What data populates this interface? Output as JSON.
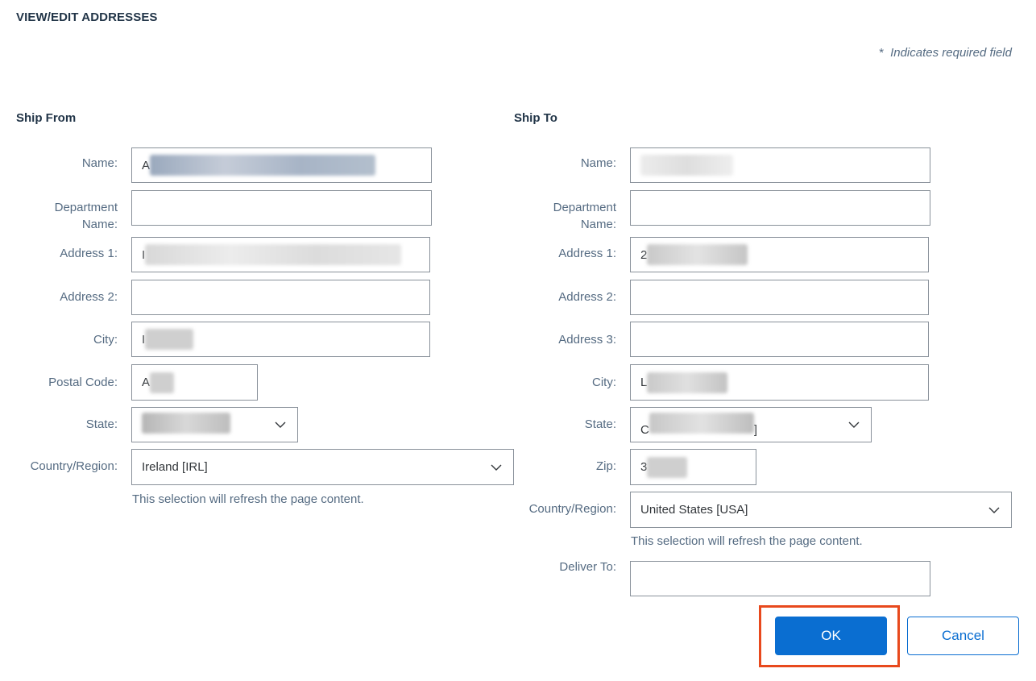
{
  "header": {
    "title": "VIEW/EDIT ADDRESSES",
    "required_star": "*",
    "required_note": "Indicates required field"
  },
  "ship_from": {
    "section_title": "Ship From",
    "labels": {
      "name": "Name:",
      "department_line1": "Department",
      "department_line2": "Name:",
      "address1": "Address 1:",
      "address2": "Address 2:",
      "city": "City:",
      "postal_code": "Postal Code:",
      "state": "State:",
      "country": "Country/Region:"
    },
    "values": {
      "name": "A",
      "address1": "I",
      "city": "I",
      "postal_code": "A",
      "country": "Ireland  [IRL]"
    },
    "country_hint": "This selection will refresh the page content."
  },
  "ship_to": {
    "section_title": "Ship To",
    "labels": {
      "name": "Name:",
      "department_line1": "Department",
      "department_line2": "Name:",
      "address1": "Address 1:",
      "address2": "Address 2:",
      "address3": "Address 3:",
      "city": "City:",
      "state": "State:",
      "zip": "Zip:",
      "country": "Country/Region:",
      "deliver_to": "Deliver To:"
    },
    "values": {
      "address1": "2",
      "city": "L",
      "state": "C",
      "state_suffix": "]",
      "zip": "3",
      "country": "United States  [USA]"
    },
    "country_hint": "This selection will refresh the page content."
  },
  "actions": {
    "ok_label": "OK",
    "cancel_label": "Cancel"
  },
  "colors": {
    "accent": "#0a6ed1",
    "highlight": "#e8491d",
    "label": "#556b82"
  },
  "icons": {
    "dropdown": "chevron-down-icon"
  }
}
